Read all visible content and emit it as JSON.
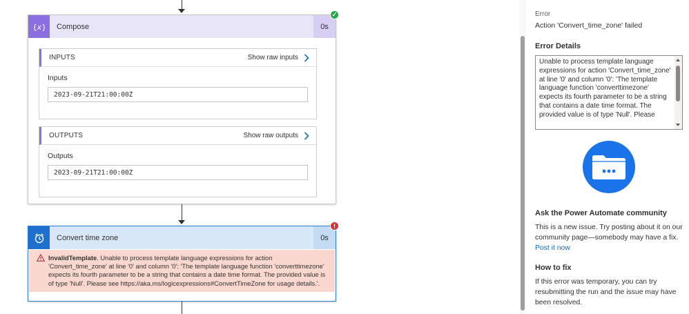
{
  "flow": {
    "compose": {
      "title": "Compose",
      "duration": "0s",
      "icon": "braces-icon",
      "status": "success",
      "inputs": {
        "header": "INPUTS",
        "link": "Show raw inputs",
        "label": "Inputs",
        "value": "2023-09-21T21:00:00Z"
      },
      "outputs": {
        "header": "OUTPUTS",
        "link": "Show raw outputs",
        "label": "Outputs",
        "value": "2023-09-21T21:00:00Z"
      }
    },
    "convert": {
      "title": "Convert time zone",
      "duration": "0s",
      "icon": "alarm-clock-icon",
      "status": "error",
      "error_code": "InvalidTemplate",
      "error_message": ". Unable to process template language expressions for action 'Convert_time_zone' at line '0' and column '0': 'The template language function 'converttimezone' expects its fourth parameter to be a string that contains a date time format. The provided value is of type 'Null'. Please see https://aka.ms/logicexpressions#ConvertTimeZone for usage details.'."
    }
  },
  "panel": {
    "error_label": "Error",
    "error_summary": "Action 'Convert_time_zone' failed",
    "details_heading": "Error Details",
    "details_text": "Unable to process template language expressions for action 'Convert_time_zone' at line '0' and column '0': 'The template language function 'converttimezone' expects its fourth parameter to be a string that contains a date time format. The provided value is of type 'Null'. Please",
    "community_heading": "Ask the Power Automate community",
    "community_text": "This is a new issue. Try posting about it on our community page—somebody may have a fix.",
    "community_link": "Post it now",
    "fix_heading": "How to fix",
    "fix_text": "If this error was temporary, you can try resubmitting the run and the issue may have been resolved."
  },
  "colors": {
    "compose_accent": "#8b6fe0",
    "convert_accent": "#1f6fcf",
    "error_bg": "#fbd8cf",
    "success": "#23a94b",
    "error": "#d13438",
    "link": "#0f6cbd"
  }
}
